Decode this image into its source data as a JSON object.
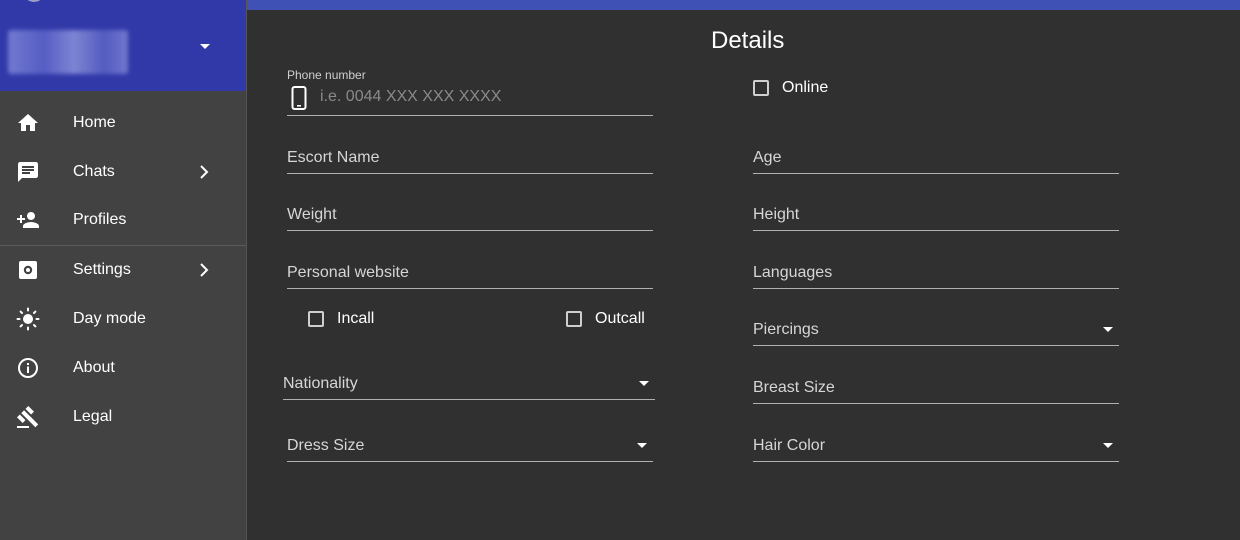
{
  "sidebar": {
    "items": [
      {
        "label": "Home",
        "icon": "home-icon",
        "has_submenu": false
      },
      {
        "label": "Chats",
        "icon": "chat-icon",
        "has_submenu": true
      },
      {
        "label": "Profiles",
        "icon": "add-person-icon",
        "has_submenu": false
      },
      {
        "label": "Settings",
        "icon": "settings-icon",
        "has_submenu": true
      },
      {
        "label": "Day mode",
        "icon": "sun-icon",
        "has_submenu": false
      },
      {
        "label": "About",
        "icon": "info-icon",
        "has_submenu": false
      },
      {
        "label": "Legal",
        "icon": "gavel-icon",
        "has_submenu": false
      }
    ]
  },
  "main": {
    "title": "Details",
    "phone": {
      "label": "Phone number",
      "placeholder": "i.e. 0044 XXX XXX XXXX",
      "value": ""
    },
    "online": {
      "label": "Online",
      "checked": false
    },
    "fields": {
      "escort_name": "Escort Name",
      "age": "Age",
      "weight": "Weight",
      "height": "Height",
      "personal_website": "Personal website",
      "languages": "Languages",
      "piercings": "Piercings",
      "nationality": "Nationality",
      "breast_size": "Breast Size",
      "dress_size": "Dress Size",
      "hair_color": "Hair Color"
    },
    "incall": {
      "label": "Incall",
      "checked": false
    },
    "outcall": {
      "label": "Outcall",
      "checked": false
    }
  },
  "colors": {
    "primary": "#3f51b5",
    "account_header": "#3139a8",
    "background": "#303030",
    "sidebar": "#424242"
  }
}
